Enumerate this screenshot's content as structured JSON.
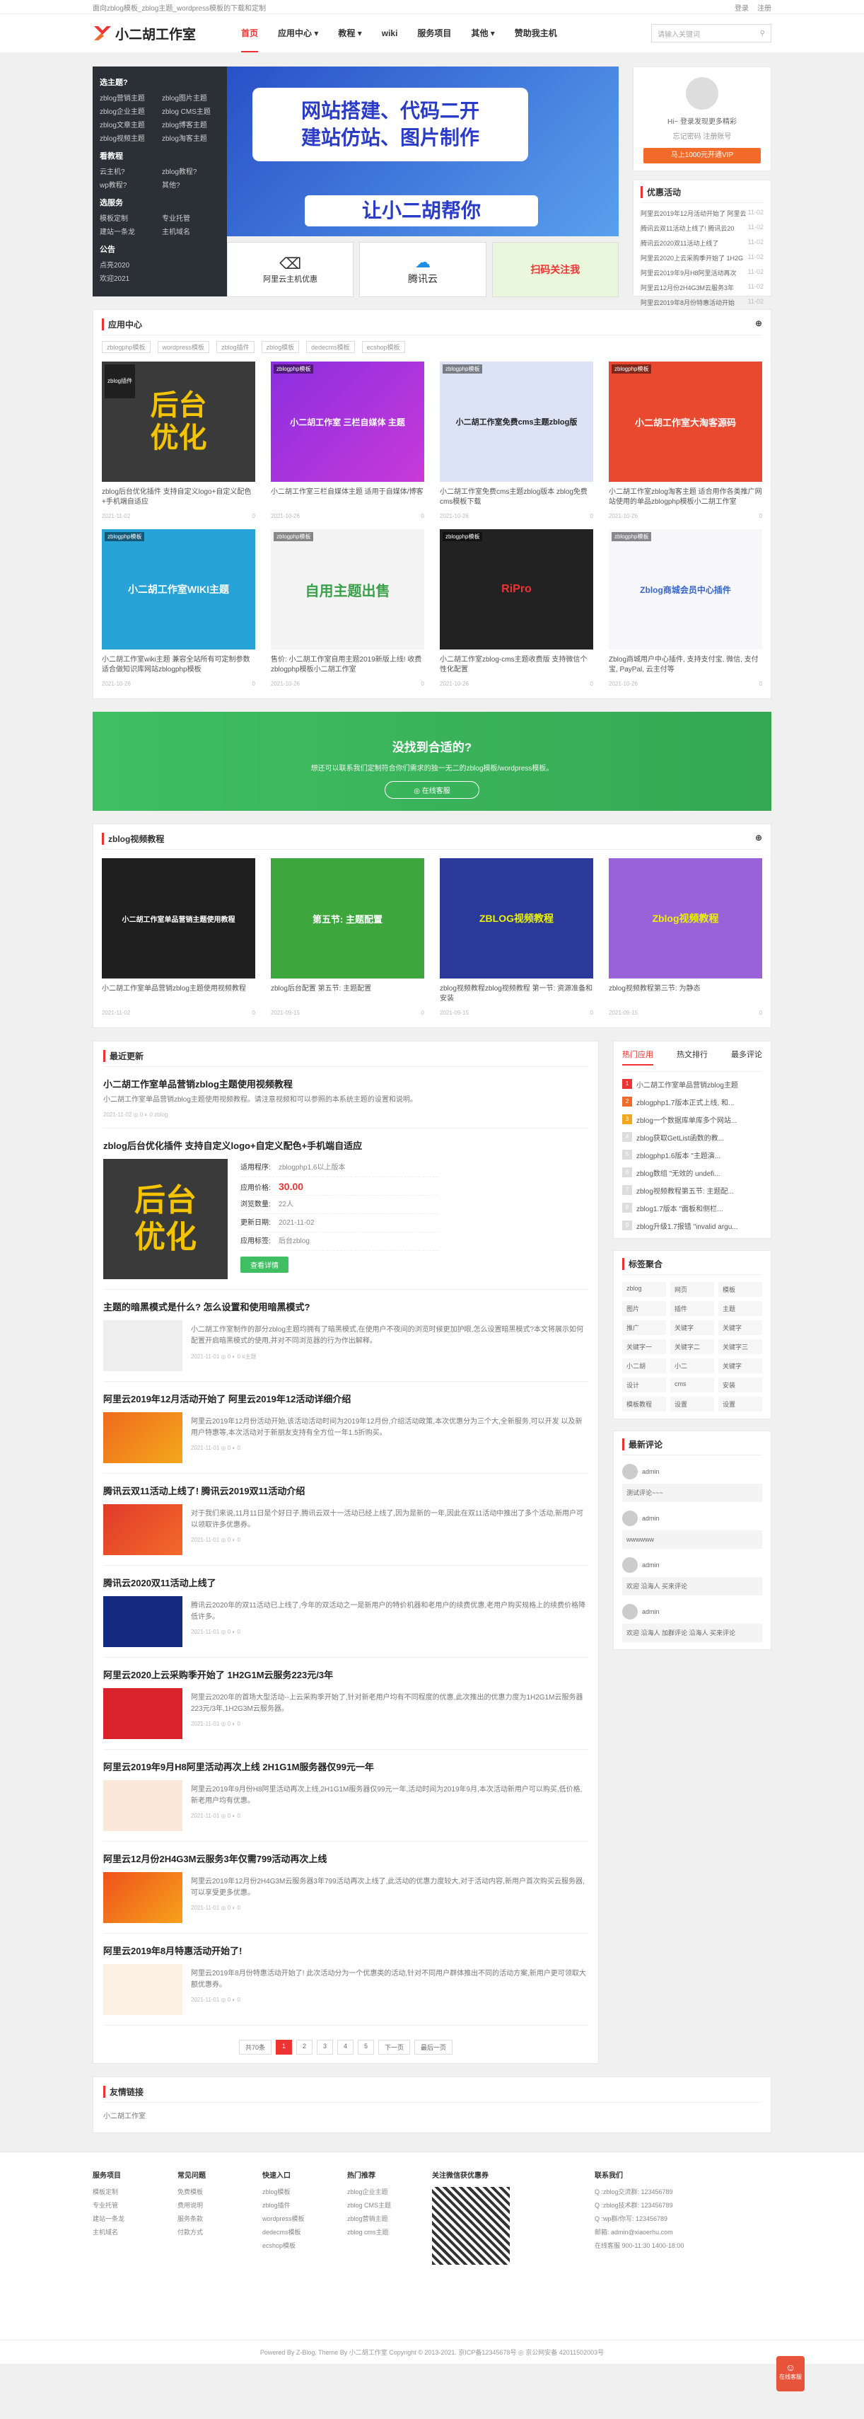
{
  "topbar": {
    "left": "面向zblog模板_zblog主题_wordpress模板的下载和定制",
    "login": "登录",
    "register": "注册"
  },
  "site": {
    "logo": "小二胡工作室"
  },
  "nav": [
    {
      "label": "首页"
    },
    {
      "label": "应用中心 ▾"
    },
    {
      "label": "教程 ▾"
    },
    {
      "label": "wiki"
    },
    {
      "label": "服务项目"
    },
    {
      "label": "其他 ▾"
    },
    {
      "label": "赞助我主机"
    }
  ],
  "search": {
    "placeholder": "请输入关键词"
  },
  "categories": {
    "c1": "选主题?",
    "c1items": [
      "zblog营销主题",
      "zblog图片主题",
      "zblog企业主题",
      "zblog CMS主题",
      "zblog文章主题",
      "zblog博客主题",
      "zblog视频主题",
      "zblog淘客主题"
    ],
    "c2": "看教程",
    "c2items": [
      "云主机?",
      "zblog教程?",
      "wp教程?",
      "其他?"
    ],
    "c3": "选服务",
    "c3items": [
      "模板定制",
      "专业托管",
      "建站一条龙",
      "主机域名"
    ],
    "c4": "公告",
    "c4items": [
      "点亮2020",
      "欢迎2021"
    ]
  },
  "banner": {
    "line1": "网站搭建、代码二开",
    "line2": "建站仿站、图片制作",
    "line3": "让小二胡帮你",
    "m1": "阿里云主机优惠",
    "m2": "腾讯云",
    "m3": "扫码关注我"
  },
  "login": {
    "hi": "Hi~ 登录发现更多精彩",
    "links": "忘记密码  注册账号",
    "vip": "马上1000元开通VIP"
  },
  "activity": {
    "title": "优惠活动",
    "items": [
      {
        "t": "阿里云2019年12月活动开始了 阿里云",
        "d": "11-02"
      },
      {
        "t": "腾讯云双11活动上线了! 腾讯云20",
        "d": "11-02"
      },
      {
        "t": "腾讯云2020双11活动上线了",
        "d": "11-02"
      },
      {
        "t": "阿里云2020上云采购季开始了 1H2G",
        "d": "11-02"
      },
      {
        "t": "阿里云2019年9月H8阿里活动再次",
        "d": "11-02"
      },
      {
        "t": "阿里云12月份2H4G3M云服务3年",
        "d": "11-02"
      },
      {
        "t": "阿里云2019年8月份特惠活动开始",
        "d": "11-02"
      }
    ]
  },
  "apps": {
    "title": "应用中心",
    "tabs": [
      "zblogphp模板",
      "wordpress模板",
      "zblog插件",
      "zblog模板",
      "dedecms模板",
      "ecshop模板"
    ],
    "items": [
      {
        "tag": "zblog插件",
        "thumb": "后台\n优化",
        "desc": "zblog后台优化插件 支持自定义logo+自定义配色+手机端自适应",
        "date": "2021-11-02",
        "n": "0"
      },
      {
        "tag": "zblogphp模板",
        "thumb": "小二胡工作室 三栏自媒体 主题",
        "desc": "小二胡工作室三栏自媒体主题 适用于自媒体/博客",
        "date": "2021-10-26",
        "n": "0"
      },
      {
        "tag": "zblogphp模板",
        "thumb": "小二胡工作室免费cms主题zblog版",
        "desc": "小二胡工作室免费cms主题zblog版本 zblog免费cms模板下载",
        "date": "2021-10-26",
        "n": "0"
      },
      {
        "tag": "zblogphp模板",
        "thumb": "小二胡工作室大淘客源码",
        "desc": "小二胡工作室zblog淘客主题 适合用作各类推广网站使用的单品zblogphp模板小二胡工作室",
        "date": "2021-10-26",
        "n": "0"
      },
      {
        "tag": "zblogphp模板",
        "thumb": "小二胡工作室WIKI主题",
        "desc": "小二胡工作室wiki主题 兼容全站所有可定制参数 适合做知识库网站zblogphp模板",
        "date": "2021-10-26",
        "n": "0"
      },
      {
        "tag": "zblogphp模板",
        "thumb": "自用主题出售",
        "desc": "售价: 小二胡工作室自用主题2019新版上线! 收费zblogphp模板小二胡工作室",
        "date": "2021-10-26",
        "n": "0"
      },
      {
        "tag": "zblogphp模板",
        "thumb": "RiPro",
        "desc": "小二胡工作室zblog-cms主题收费版 支持微信个性化配置",
        "date": "2021-10-26",
        "n": "0"
      },
      {
        "tag": "zblogphp模板",
        "thumb": "Zblog商城会员中心插件",
        "desc": "Zblog商城用户中心插件, 支持支付宝, 微信, 支付宝, PayPal, 云主付等",
        "date": "2021-10-26",
        "n": "0"
      }
    ]
  },
  "promo": {
    "title": "没找到合适的?",
    "text": "想还可以联系我们定制符合你们需求的独一无二的zblog模板/wordpress模板。",
    "btn": "◎ 在线客服"
  },
  "videos": {
    "title": "zblog视频教程",
    "items": [
      {
        "thumb": "小二胡工作室单品营销主题使用教程",
        "desc": "小二胡工作室单品营销zblog主题使用视频教程",
        "date": "2021-11-02",
        "n": "0"
      },
      {
        "thumb": "第五节: 主题配置",
        "desc": "zblog后台配置 第五节: 主题配置",
        "date": "2021-09-15",
        "n": "0"
      },
      {
        "thumb": "ZBLOG视频教程",
        "desc": "zblog视频教程zblog视频教程 第一节: 资源准备和安装",
        "date": "2021-09-15",
        "n": "0"
      },
      {
        "thumb": "Zblog视频教程",
        "desc": "zblog视频教程第三节: 为静态",
        "date": "2021-09-15",
        "n": "0"
      }
    ]
  },
  "latest": {
    "title": "最近更新",
    "p1": {
      "title": "小二胡工作室单品营销zblog主题使用视频教程",
      "text": "小二胡工作室单品营销zblog主题使用视频教程。请注意视频和可以参照的本系统主题的设置和说明。",
      "meta": "2021-11-02  ◎ 0  ◐ 0  zblog"
    },
    "p2": {
      "title": "zblog后台优化插件 支持自定义logo+自定义配色+手机端自适应",
      "pic": "后台\n优化",
      "r1k": "适用程序:",
      "r1v": "zblogphp1.6以上版本",
      "r2k": "应用价格:",
      "r2v": "30.00",
      "r3k": "浏览数量:",
      "r3v": "22人",
      "r4k": "更新日期:",
      "r4v": "2021-11-02",
      "r5k": "应用标签:",
      "r5v": "后台zblog",
      "buy": "查看详情"
    },
    "posts": [
      {
        "title": "主题的暗黑模式是什么? 怎么设置和使用暗黑模式?",
        "text": "小二胡工作室制作的部分zblog主题均拥有了暗黑模式,在使用户不夜间的浏览时候更加护眼,怎么设置暗黑模式?本文将展示如何配置开启暗黑模式的使用,并对不同浏览器的行为作出解释。",
        "meta": "2021-11-01  ◎ 0  ◐ 0  #主题"
      },
      {
        "title": "阿里云2019年12月活动开始了 阿里云2019年12活动详细介绍",
        "text": "阿里云2019年12月份活动开始,该活动活动时间为2019年12月份,介绍活动政策,本次优惠分为三个大,全新服务,可以开发 以及新用户特惠等,本次活动对于新朋友支持有全方位一年1.5折购买。",
        "meta": "2021-11-01  ◎ 0  ◐ 0"
      },
      {
        "title": "腾讯云双11活动上线了! 腾讯云2019双11活动介绍",
        "text": "对于我们来说,11月11日是个好日子,腾讯云双十一活动已经上线了,因为是新的一年,因此在双11活动中推出了多个活动,新用户可以领取许多优惠券。",
        "meta": "2021-11-01  ◎ 0  ◐ 0"
      },
      {
        "title": "腾讯云2020双11活动上线了",
        "text": "腾讯云2020年的双11活动已上线了,今年的双活动之一是新用户的特价机器和老用户的续费优惠,老用户购买规格上的续费价格降低许多。",
        "meta": "2021-11-01  ◎ 0  ◐ 0"
      },
      {
        "title": "阿里云2020上云采购季开始了 1H2G1M云服务223元/3年",
        "text": "阿里云2020年的首场大型活动--上云采购季开始了,针对新老用户均有不同程度的优惠,此次推出的优惠力度为1H2G1M云服务器223元/3年,1H2G3M云服务器。",
        "meta": "2021-11-01  ◎ 0  ◐ 0"
      },
      {
        "title": "阿里云2019年9月H8阿里活动再次上线 2H1G1M服务器仅99元一年",
        "text": "阿里云2019年9月份H8阿里活动再次上线,2H1G1M服务器仅99元一年,活动时间为2019年9月,本次活动新用户可以购买,低价格,新老用户均有优惠。",
        "meta": "2021-11-01  ◎ 0  ◐ 0"
      },
      {
        "title": "阿里云12月份2H4G3M云服务3年仅需799活动再次上线",
        "text": "阿里云2019年12月份2H4G3M云服务器3年799活动再次上线了,此活动的优惠力度较大,对于活动内容,新用户首次购买云服务器,可以享受更多优惠。",
        "meta": "2021-11-01  ◎ 0  ◐ 0"
      },
      {
        "title": "阿里云2019年8月特惠活动开始了!",
        "text": "阿里云2019年8月份特惠活动开始了! 此次活动分为一个优惠类的活动,针对不同用户群体推出不同的活动方案,新用户更可领取大额优惠券。",
        "meta": "2021-11-01  ◎ 0  ◐ 0"
      }
    ],
    "pager": [
      "共70条",
      "1",
      "2",
      "3",
      "4",
      "5",
      "下一页",
      "最后一页"
    ]
  },
  "hot": {
    "tabs": [
      "热门应用",
      "热文排行",
      "最多评论"
    ],
    "items": [
      "小二胡工作室单品营销zblog主题",
      "zblogphp1.7版本正式上线, 和...",
      "zblog一个数据库单库多个网站...",
      "zblog获取GetList函数的教...",
      "zblogphp1.6版本 \"主题演...",
      "zblog数组 \"无效的 undefi...",
      "zblog视频教程第五节: 主题配...",
      "zblog1.7版本 \"面板和侧栏...",
      "zblog升级1.7报错 \"invalid argu..."
    ]
  },
  "tagcloud": {
    "title": "标签聚合",
    "tags": [
      "zblog",
      "网页",
      "模板",
      "图片",
      "插件",
      "主题",
      "推广",
      "关键字",
      "关键字",
      "关键字一",
      "关键字二",
      "关键字三",
      "小二胡",
      "小二",
      "关键字",
      "设计",
      "cms",
      "安装",
      "模板教程",
      "设置",
      "设置"
    ]
  },
  "comments": {
    "title": "最新评论",
    "items": [
      {
        "who": "admin",
        "text": "测试评论~~~"
      },
      {
        "who": "admin",
        "text": "wwwwww"
      },
      {
        "who": "admin",
        "text": "欢迎 沿海人 买来评论"
      },
      {
        "who": "admin",
        "text": "欢迎 沿海人 加群评论 沿海人 买来评论"
      }
    ]
  },
  "friend": {
    "title": "友情链接",
    "items": [
      "小二胡工作室"
    ]
  },
  "footer": {
    "cols": [
      {
        "h": "服务项目",
        "items": [
          "模板定制",
          "专业托管",
          "建站一条龙",
          "主机域名"
        ]
      },
      {
        "h": "常见问题",
        "items": [
          "免费模板",
          "费用说明",
          "服务条款",
          "付款方式"
        ]
      },
      {
        "h": "快速入口",
        "items": [
          "zblog模板",
          "zblog插件",
          "wordpress模板",
          "dedecms模板",
          "ecshop模板"
        ]
      },
      {
        "h": "热门推荐",
        "items": [
          "zblog企业主题",
          "zblog CMS主题",
          "zblog营销主题",
          "zblog cms主题"
        ]
      }
    ],
    "qrtitle": "关注微信获优惠券",
    "contact": {
      "h": "联系我们",
      "items": [
        "Q :zblog交流群: 123456789",
        "Q :zblog技术群: 123456789",
        "Q :wp群/你写: 123456789",
        "邮箱: admin@xiaoerhu.com",
        "在线客服 900-11:30 1400-18:00"
      ]
    },
    "copy": "Powered By Z-Blog.  Theme By 小二胡工作室  Copyright © 2013-2021.  京ICP备12345678号  ◎ 京公网安备 42011502003号"
  },
  "float": {
    "label": "在线客服"
  }
}
